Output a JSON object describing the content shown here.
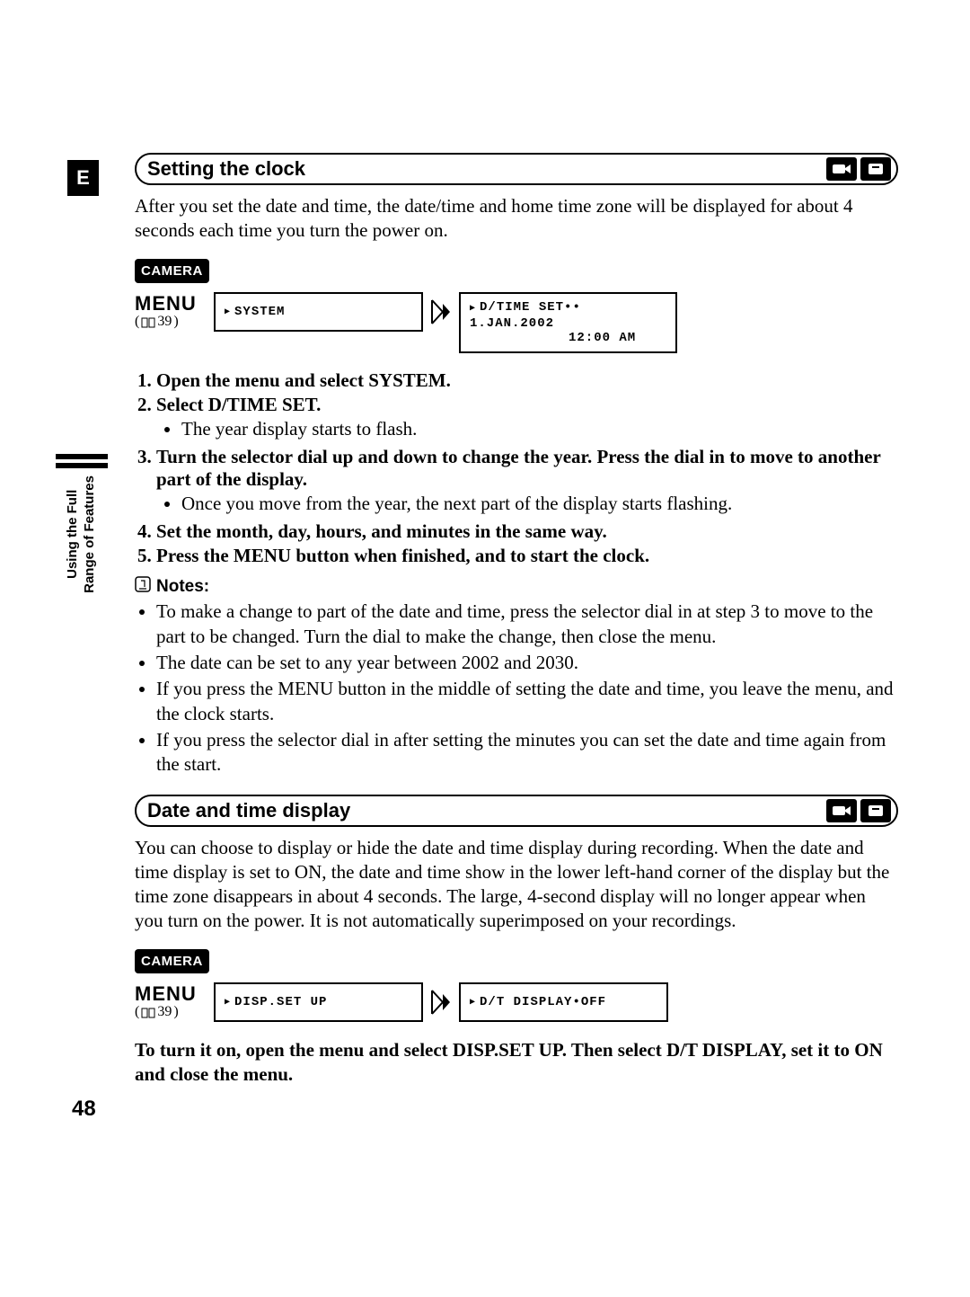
{
  "language_tab": "E",
  "sidebar": {
    "line1": "Using the Full",
    "line2": "Range of Features"
  },
  "section1": {
    "title": "Setting the clock",
    "intro": "After you set the date and time, the date/time and home time zone will be displayed for about 4 seconds each time you turn the power on.",
    "camera_tag": "CAMERA",
    "menu_label": "MENU",
    "menu_ref_page": "39",
    "menu_box1": "SYSTEM",
    "menu_box2_line1": "D/TIME SET•• 1.JAN.2002",
    "menu_box2_line2": "12:00 AM",
    "steps": [
      {
        "text": "Open the menu and select SYSTEM."
      },
      {
        "text": "Select D/TIME SET.",
        "bullets": [
          "The year display starts to flash."
        ]
      },
      {
        "text": "Turn the selector dial up and down to change the year. Press the dial in to move to another part of the display.",
        "bullets": [
          "Once you move from the year, the next part of the display starts flashing."
        ]
      },
      {
        "text": "Set the month, day, hours, and minutes in the same way."
      },
      {
        "text": "Press the MENU button when finished, and to start the clock."
      }
    ],
    "notes_label": "Notes:",
    "notes": [
      "To make a change to part of the date and time, press the selector dial in at step 3 to move to the part to be changed. Turn the dial to make the change, then close the menu.",
      "The date can be set to any year between 2002 and 2030.",
      "If you press the MENU button in the middle of setting the date and time, you leave the menu, and the clock starts.",
      "If you press the selector dial in after setting the minutes you can set the date and time again from the start."
    ]
  },
  "section2": {
    "title": "Date and time display",
    "intro": "You can choose to display or hide the date and time display during recording. When the date and time display is set to ON, the date and time show in the lower left-hand corner of the display but the time zone disappears in about 4 seconds. The large, 4-second display will no longer appear when you turn on the power. It is not automatically superimposed on your recordings.",
    "camera_tag": "CAMERA",
    "menu_label": "MENU",
    "menu_ref_page": "39",
    "menu_box1": "DISP.SET UP",
    "menu_box2": "D/T DISPLAY•OFF",
    "final": "To turn it on, open the menu and select DISP.SET UP. Then select D/T DISPLAY, set it to ON and close the menu."
  },
  "page_number": "48"
}
